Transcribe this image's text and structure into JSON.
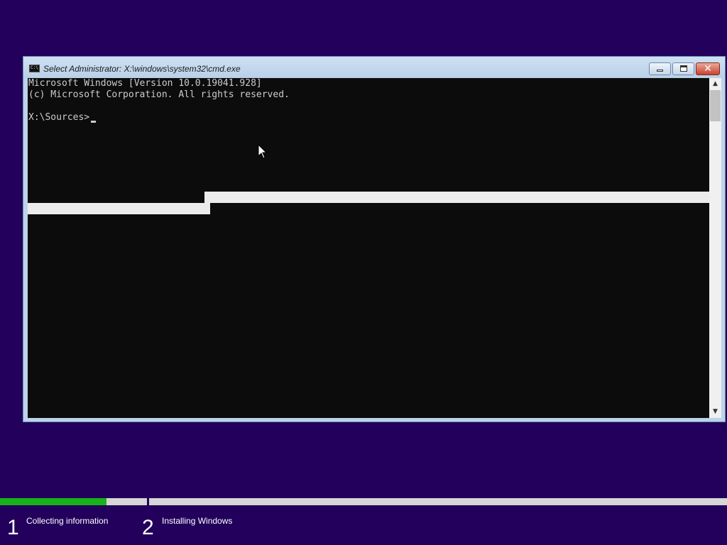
{
  "window": {
    "title": "Select Administrator: X:\\windows\\system32\\cmd.exe",
    "icon": "cmd-icon",
    "icon_text": "C:\\"
  },
  "console": {
    "lines": [
      "Microsoft Windows [Version 10.0.19041.928]",
      "(c) Microsoft Corporation. All rights reserved.",
      "",
      "X:\\Sources>"
    ]
  },
  "scrollbar": {
    "up_arrow": "▲",
    "down_arrow": "▼"
  },
  "caption_buttons": {
    "close_glyph": "✕"
  },
  "setup": {
    "progress": 0.146,
    "steps": [
      {
        "number": "1",
        "label": "Collecting information"
      },
      {
        "number": "2",
        "label": "Installing Windows"
      }
    ]
  },
  "colors": {
    "background": "#22005c",
    "progress": "#18b31a",
    "console_bg": "#0c0c0c",
    "console_text": "#cccccc"
  }
}
